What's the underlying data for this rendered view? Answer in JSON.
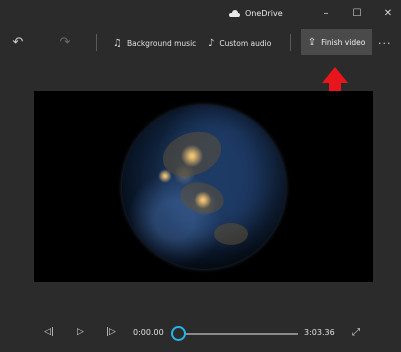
{
  "window": {
    "title": "OneDrive",
    "controls": {
      "minimize": "–",
      "maximize": "☐",
      "close": "✕"
    }
  },
  "toolbar": {
    "undo": "↶",
    "redo": "↷",
    "background_music": "Background music",
    "custom_audio": "Custom audio",
    "finish_video": "Finish video",
    "more": "···"
  },
  "annotation": {
    "arrow_color": "#e8161c"
  },
  "player": {
    "current_time": "0:00.00",
    "total_time": "3:03.36",
    "progress": 0,
    "accent": "#26b4e6"
  }
}
